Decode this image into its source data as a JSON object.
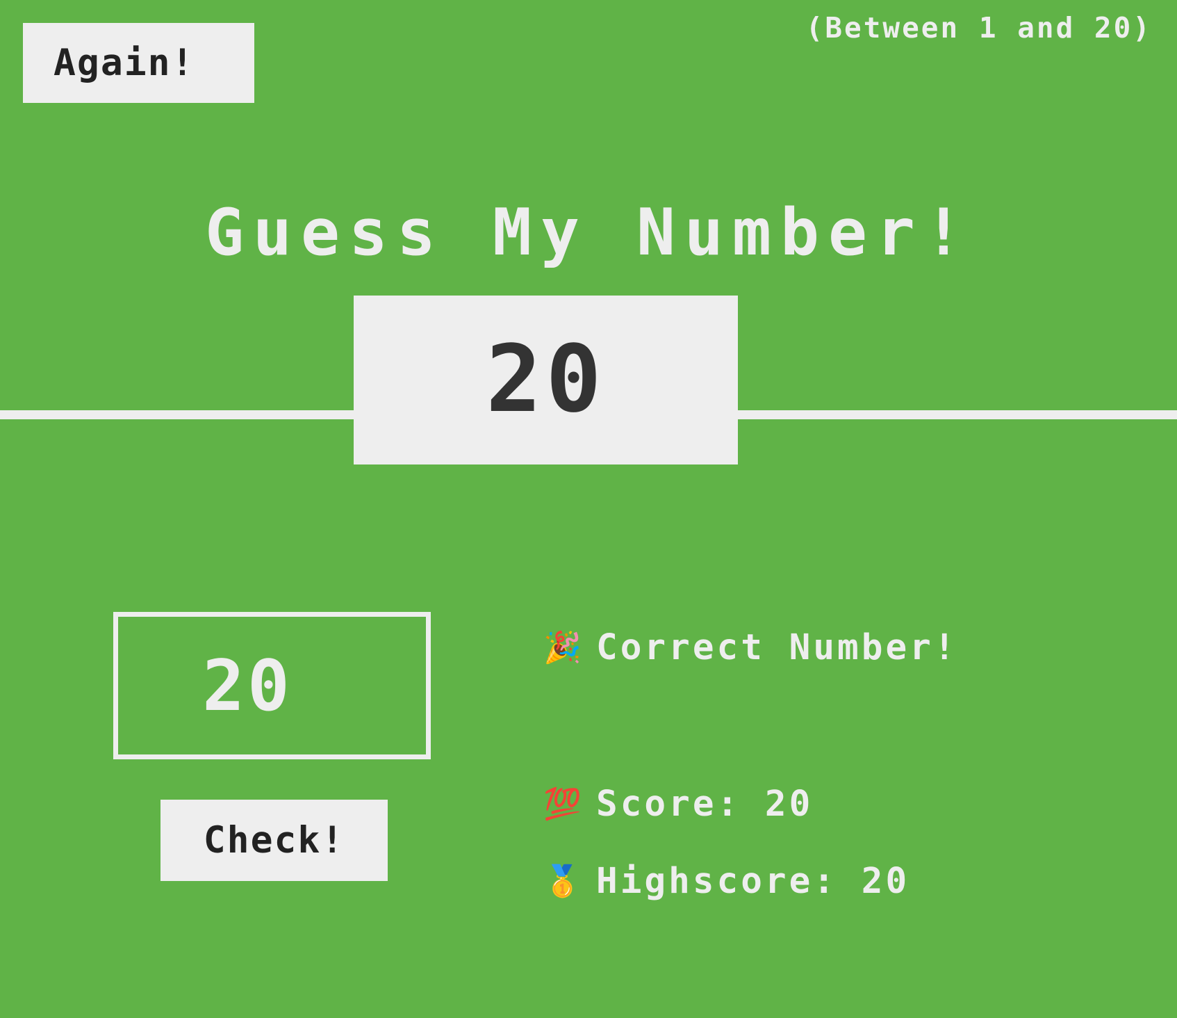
{
  "app": {
    "title": "Guess My Number!",
    "background_color": "#60b347",
    "surface_color": "#eeeeee",
    "text_dark_color": "#222222"
  },
  "header": {
    "again_label": "Again!",
    "range_hint": "(Between 1 and 20)"
  },
  "secret_number": {
    "display": "20"
  },
  "guess": {
    "value": "20",
    "min": "1",
    "max": "20",
    "placeholder": ""
  },
  "actions": {
    "check_label": "Check!"
  },
  "status": {
    "message_icon": "party-popper",
    "message_emoji": "🎉",
    "message": "Correct Number!",
    "score_icon": "hundred-points",
    "score_emoji": "💯",
    "score_label": "Score: 20",
    "highscore_icon": "gold-medal",
    "highscore_emoji": "🥇",
    "highscore_label": "Highscore: 20"
  }
}
